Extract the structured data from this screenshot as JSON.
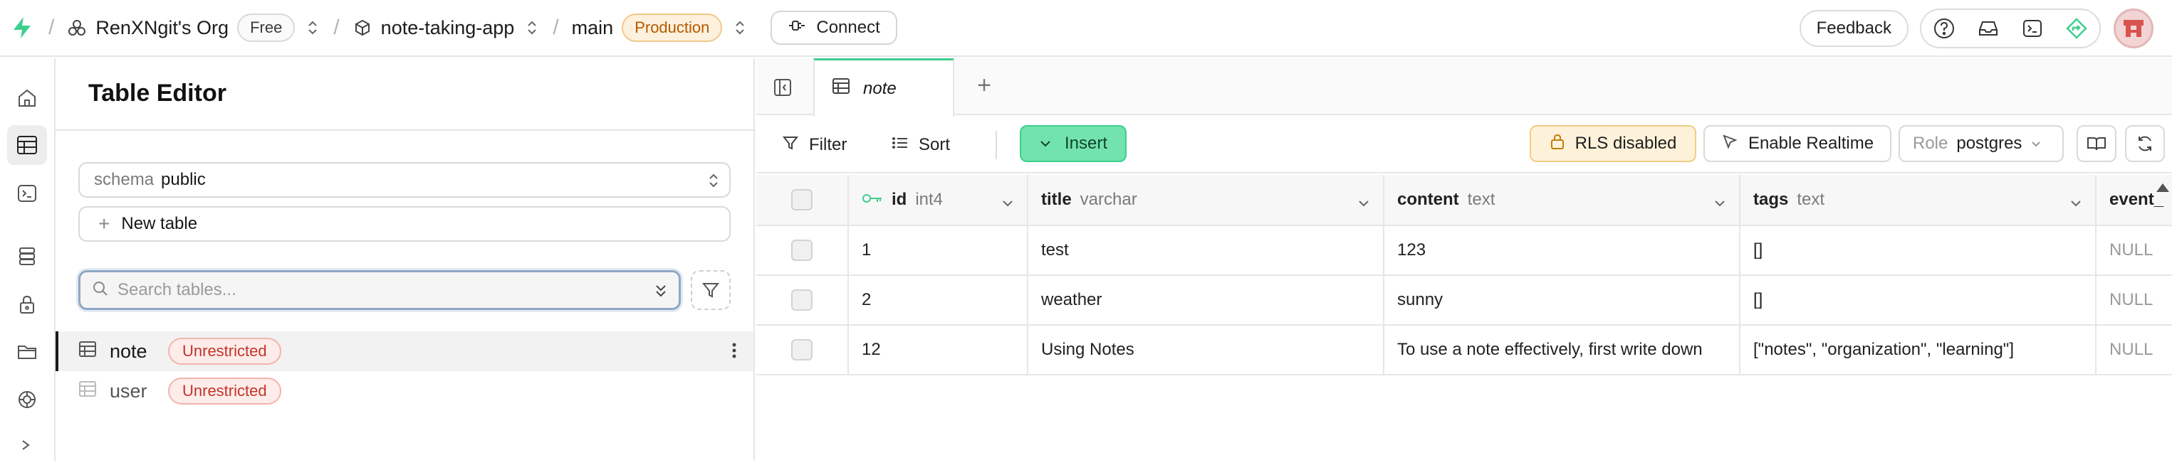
{
  "topbar": {
    "org_name": "RenXNgit's Org",
    "org_plan": "Free",
    "project_name": "note-taking-app",
    "branch_name": "main",
    "branch_env": "Production",
    "connect_label": "Connect",
    "feedback_label": "Feedback",
    "accent_color": "#3ecf8e"
  },
  "sidebar": {
    "title": "Table Editor",
    "schema_label": "schema",
    "schema_value": "public",
    "new_table_label": "New table",
    "search_placeholder": "Search tables...",
    "tables": [
      {
        "name": "note",
        "badge": "Unrestricted",
        "active": true
      },
      {
        "name": "user",
        "badge": "Unrestricted",
        "active": false
      }
    ]
  },
  "main": {
    "tab_label": "note",
    "toolbar": {
      "filter_label": "Filter",
      "sort_label": "Sort",
      "insert_label": "Insert",
      "rls_label": "RLS disabled",
      "realtime_label": "Enable Realtime",
      "role_label": "Role",
      "role_value": "postgres"
    },
    "columns": [
      {
        "name": "id",
        "type": "int4",
        "primary_key": true
      },
      {
        "name": "title",
        "type": "varchar"
      },
      {
        "name": "content",
        "type": "text"
      },
      {
        "name": "tags",
        "type": "text"
      },
      {
        "name": "event_",
        "type": ""
      }
    ],
    "rows": [
      {
        "id": "1",
        "title": "test",
        "content": "123",
        "tags": "[]",
        "event": "NULL"
      },
      {
        "id": "2",
        "title": "weather",
        "content": "sunny",
        "tags": "[]",
        "event": "NULL"
      },
      {
        "id": "12",
        "title": "Using Notes",
        "content": "To use a note effectively, first write down",
        "tags": "[\"notes\", \"organization\", \"learning\"]",
        "event": "NULL"
      }
    ]
  }
}
